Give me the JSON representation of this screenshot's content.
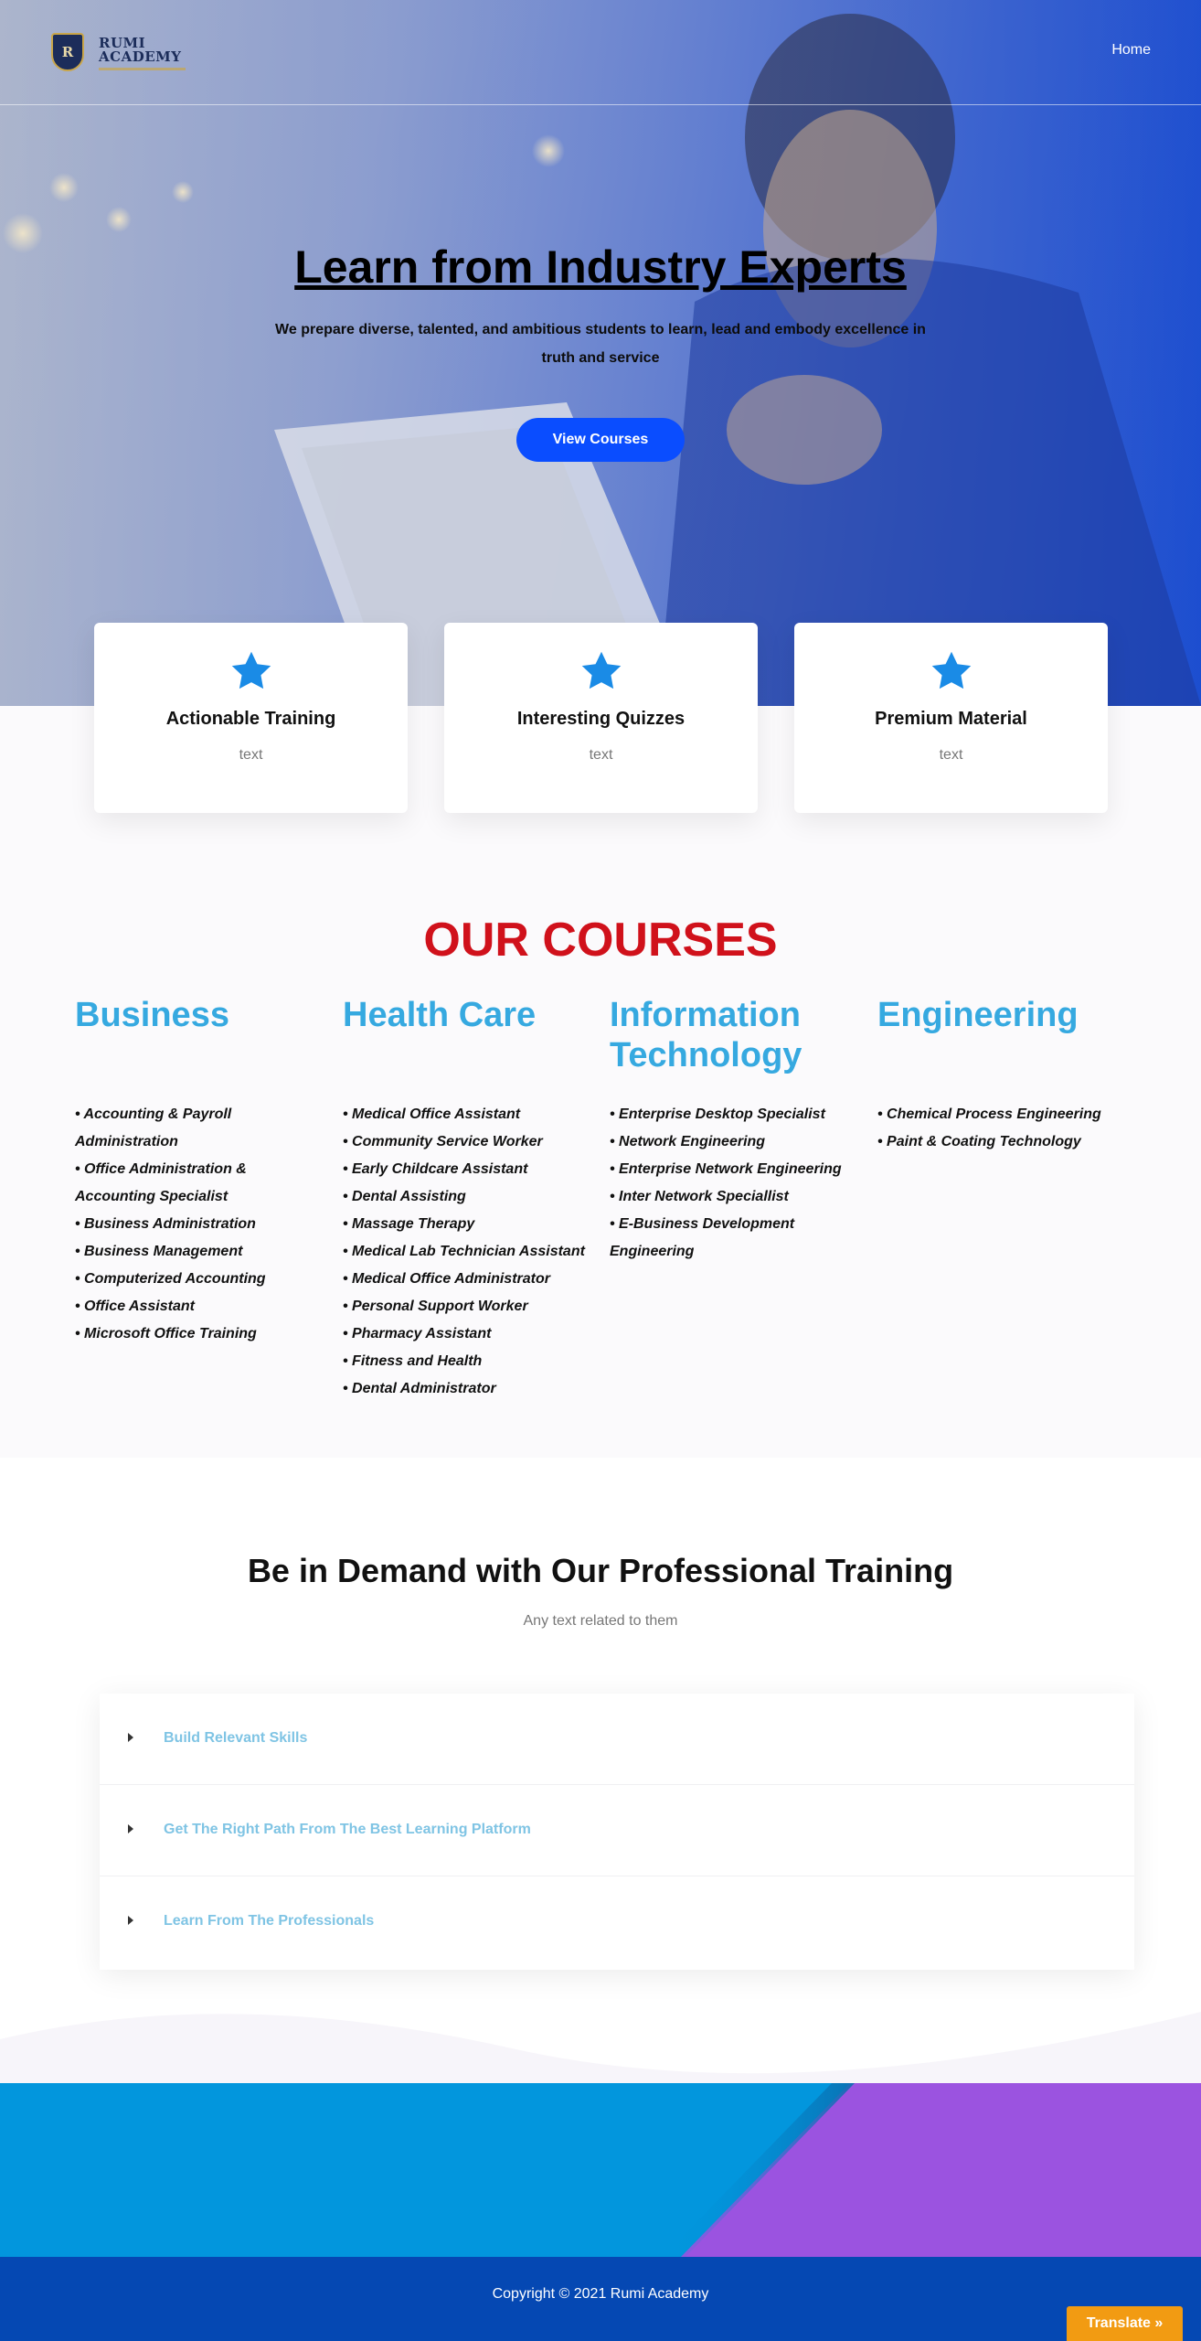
{
  "header": {
    "logo_line1": "RUMI",
    "logo_line2": "ACADEMY",
    "logo_letter": "R",
    "nav_home": "Home"
  },
  "hero": {
    "title": "Learn from Industry Experts",
    "subtitle": "We prepare diverse, talented, and ambitious students to learn, lead and embody excellence in truth and service",
    "button": "View Courses"
  },
  "features": [
    {
      "title": "Actionable Training",
      "text": "text",
      "icon": "star-icon"
    },
    {
      "title": "Interesting Quizzes",
      "text": "text",
      "icon": "star-icon"
    },
    {
      "title": "Premium Material",
      "text": "text",
      "icon": "star-icon"
    }
  ],
  "courses": {
    "heading": "OUR COURSES",
    "columns": [
      {
        "title": "Business",
        "items": [
          "• Accounting & Payroll Administration",
          "• Office Administration & Accounting Specialist",
          "• Business Administration",
          "• Business Management",
          "• Computerized Accounting",
          "• Office Assistant",
          "• Microsoft Office Training"
        ]
      },
      {
        "title": "Health Care",
        "items": [
          "• Medical Office Assistant",
          "• Community Service Worker",
          "• Early Childcare Assistant",
          "• Dental Assisting",
          "• Massage Therapy",
          "• Medical Lab Technician Assistant",
          "• Medical Office Administrator",
          "• Personal Support Worker",
          "• Pharmacy Assistant",
          "• Fitness and Health",
          "• Dental Administrator"
        ]
      },
      {
        "title": "Information Technology",
        "items": [
          "• Enterprise Desktop Specialist",
          "• Network Engineering",
          "• Enterprise Network Engineering",
          "• Inter Network Speciallist",
          "• E-Business Development Engineering"
        ]
      },
      {
        "title": "Engineering",
        "items": [
          "• Chemical Process Engineering",
          "• Paint & Coating Technology"
        ]
      }
    ]
  },
  "demand": {
    "title": "Be in Demand with Our Professional Training",
    "subtitle": "Any text related to them",
    "accordion": [
      "Build Relevant Skills",
      "Get The Right Path From The Best Learning Platform",
      "Learn From The Professionals"
    ]
  },
  "footer": {
    "copyright": "Copyright © 2021 Rumi Academy",
    "translate": "Translate »"
  },
  "colors": {
    "accent_blue": "#0a4dff",
    "course_title": "#36a9e0",
    "courses_heading": "#d0111b",
    "footer": "#0548b3",
    "translate": "#f29b12"
  }
}
